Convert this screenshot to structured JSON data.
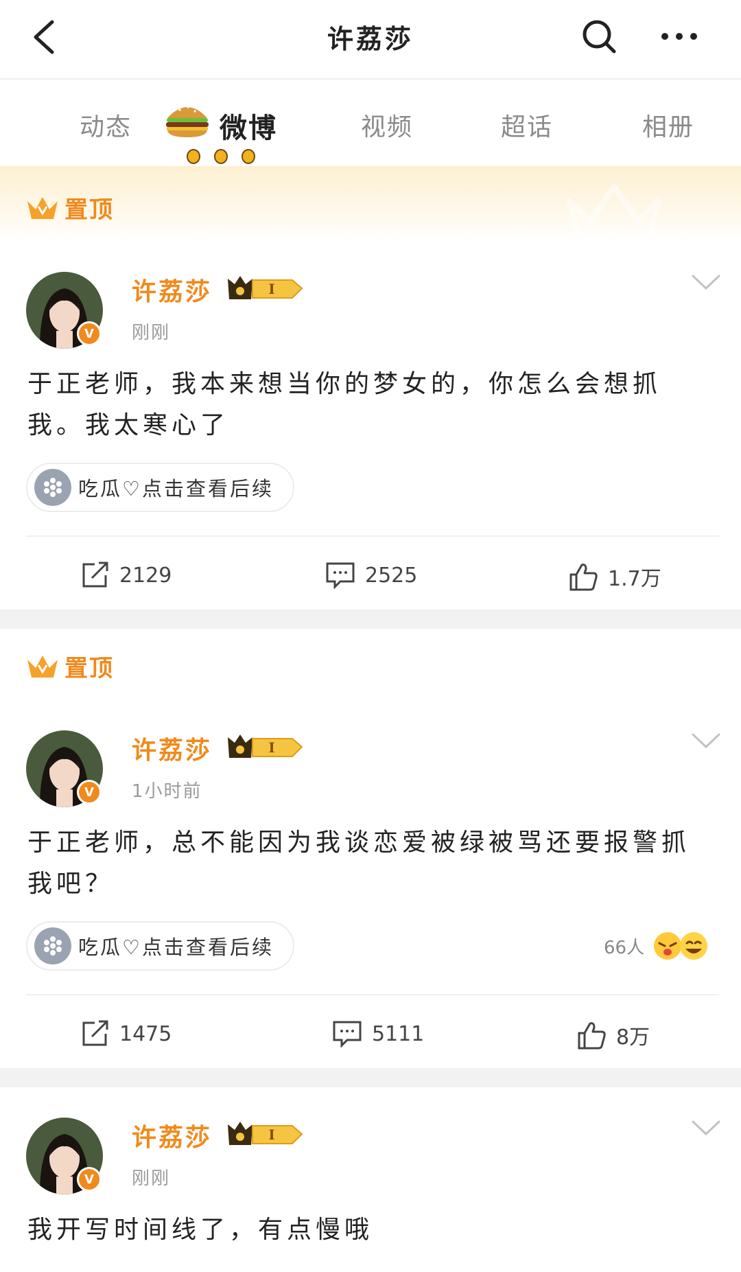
{
  "header": {
    "title": "许荔莎"
  },
  "tabs": [
    {
      "label": "动态"
    },
    {
      "label": "微博"
    },
    {
      "label": "视频"
    },
    {
      "label": "超话"
    },
    {
      "label": "相册"
    }
  ],
  "pinned_label": "置顶",
  "posts": [
    {
      "author": "许荔莎",
      "vip_level": "I",
      "time": "刚刚",
      "verify_mark": "V",
      "text": "于正老师，我本来想当你的梦女的，你怎么会想抓我。我太寒心了",
      "topic": "吃瓜♡点击查看后续",
      "reposts": "2129",
      "comments": "2525",
      "likes": "1.7万"
    },
    {
      "author": "许荔莎",
      "vip_level": "I",
      "time": "1小时前",
      "verify_mark": "V",
      "text": "于正老师，总不能因为我谈恋爱被绿被骂还要报警抓我吧？",
      "topic": "吃瓜♡点击查看后续",
      "reaction_count": "66人",
      "reposts": "1475",
      "comments": "5111",
      "likes": "8万"
    },
    {
      "author": "许荔莎",
      "vip_level": "I",
      "time": "刚刚",
      "verify_mark": "V",
      "text": "我开写时间线了，有点慢哦"
    }
  ],
  "colors": {
    "accent": "#f08a1c",
    "separator": "#f2f2f2"
  },
  "icons": [
    "back-arrow-icon",
    "search-icon",
    "more-icon",
    "hamburger-sticker-icon",
    "crown-icon",
    "chevron-down-icon",
    "repost-icon",
    "comment-icon",
    "like-icon",
    "topic-icon",
    "emoji-icon"
  ]
}
